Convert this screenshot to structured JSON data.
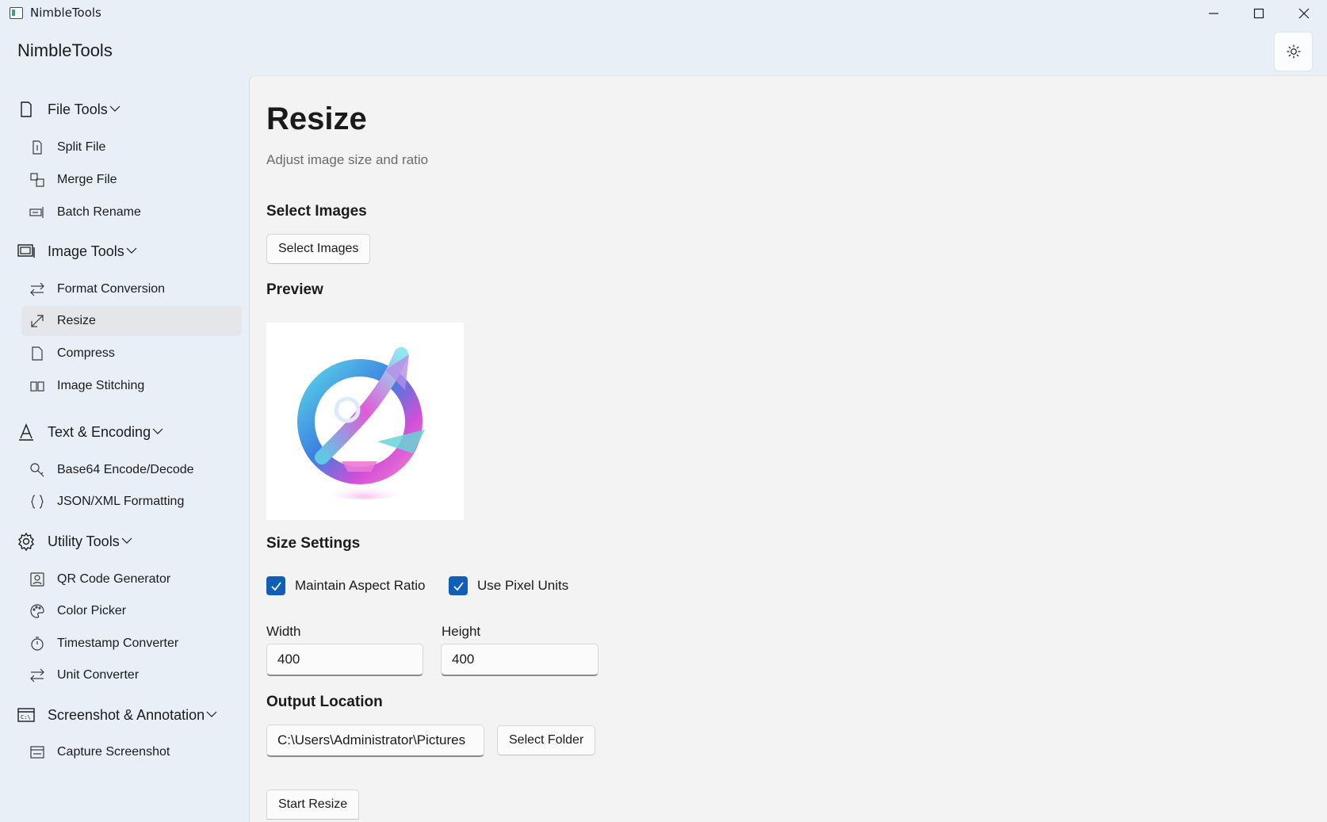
{
  "window": {
    "title": "NimbleTools",
    "controls": {
      "minimize": "minimize-icon",
      "maximize": "maximize-icon",
      "close": "close-icon"
    }
  },
  "header": {
    "app_title": "NimbleTools",
    "theme_toggle_icon": "sun-icon"
  },
  "sidebar": {
    "categories": [
      {
        "label": "File Tools",
        "icon": "file-icon",
        "items": [
          {
            "label": "Split File",
            "icon": "split-file-icon"
          },
          {
            "label": "Merge File",
            "icon": "merge-file-icon"
          },
          {
            "label": "Batch Rename",
            "icon": "rename-icon"
          }
        ]
      },
      {
        "label": "Image Tools",
        "icon": "images-icon",
        "items": [
          {
            "label": "Format Conversion",
            "icon": "swap-icon"
          },
          {
            "label": "Resize",
            "icon": "resize-icon",
            "selected": true
          },
          {
            "label": "Compress",
            "icon": "document-icon"
          },
          {
            "label": "Image Stitching",
            "icon": "stitch-icon"
          }
        ]
      },
      {
        "label": "Text & Encoding",
        "icon": "font-icon",
        "items": [
          {
            "label": "Base64 Encode/Decode",
            "icon": "key-icon"
          },
          {
            "label": "JSON/XML Formatting",
            "icon": "braces-icon"
          }
        ]
      },
      {
        "label": "Utility Tools",
        "icon": "gear-icon",
        "items": [
          {
            "label": "QR Code Generator",
            "icon": "contact-icon"
          },
          {
            "label": "Color Picker",
            "icon": "palette-icon"
          },
          {
            "label": "Timestamp Converter",
            "icon": "timer-icon"
          },
          {
            "label": "Unit Converter",
            "icon": "swap-icon"
          }
        ]
      },
      {
        "label": "Screenshot & Annotation",
        "icon": "console-icon",
        "items": [
          {
            "label": "Capture Screenshot",
            "icon": "screenshot-icon"
          }
        ]
      }
    ]
  },
  "main": {
    "title": "Resize",
    "subtitle": "Adjust image size and ratio",
    "select_images": {
      "heading": "Select Images",
      "button": "Select Images"
    },
    "preview": {
      "heading": "Preview",
      "image": "abstract-3d-logo-image"
    },
    "size_settings": {
      "heading": "Size Settings",
      "maintain_aspect": {
        "label": "Maintain Aspect Ratio",
        "checked": true
      },
      "pixel_units": {
        "label": "Use Pixel Units",
        "checked": true
      },
      "width": {
        "label": "Width",
        "value": "400"
      },
      "height": {
        "label": "Height",
        "value": "400"
      }
    },
    "output": {
      "heading": "Output Location",
      "path": "C:\\Users\\Administrator\\Pictures",
      "button": "Select Folder"
    },
    "start_button": "Start Resize"
  },
  "colors": {
    "accent": "#0f5fb8",
    "window_bg": "#e9eff7",
    "content_bg": "#f3f3f3",
    "selected_item_bg": "#e4e6e9"
  }
}
